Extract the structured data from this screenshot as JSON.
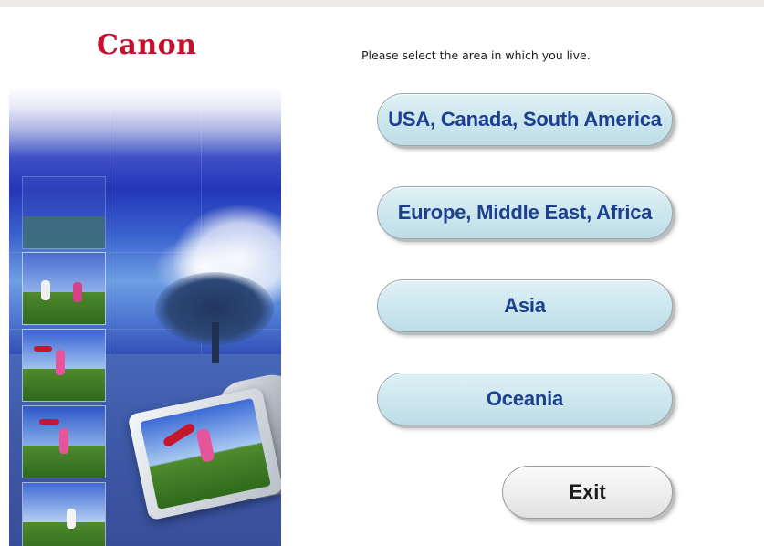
{
  "brand": {
    "logo_text": "Canon",
    "logo_color": "#c8102e"
  },
  "prompt": "Please select the area in which you live.",
  "regions": [
    {
      "label": "USA, Canada, South America"
    },
    {
      "label": "Europe, Middle East, Africa"
    },
    {
      "label": "Asia"
    },
    {
      "label": "Oceania"
    }
  ],
  "exit_label": "Exit",
  "colors": {
    "region_button_text": "#1d3f8f",
    "region_button_fill": "#cbe6ee",
    "exit_button_fill": "#ececec"
  }
}
